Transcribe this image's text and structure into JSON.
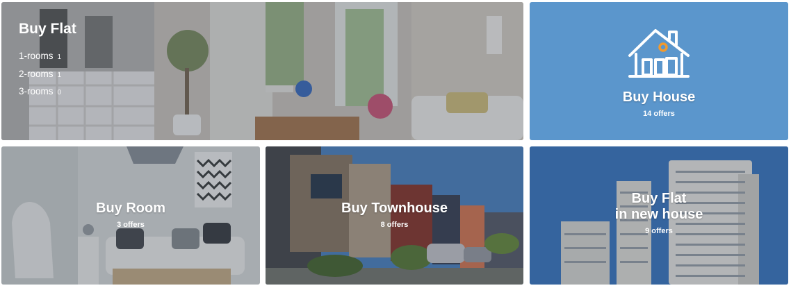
{
  "tiles": {
    "flat": {
      "title": "Buy Flat",
      "rooms": [
        {
          "label": "1-rooms",
          "count": "1"
        },
        {
          "label": "2-rooms",
          "count": "1"
        },
        {
          "label": "3-rooms",
          "count": "0"
        }
      ]
    },
    "house": {
      "title": "Buy House",
      "offers": "14 offers",
      "icon": "house-icon"
    },
    "room": {
      "title": "Buy Room",
      "offers": "3 offers"
    },
    "townhouse": {
      "title": "Buy Townhouse",
      "offers": "8 offers"
    },
    "new_flat": {
      "title_line1": "Buy Flat",
      "title_line2": "in new house",
      "offers": "9 offers"
    }
  },
  "colors": {
    "house_tile": "#5b96cc",
    "icon_accent": "#f29a2e"
  }
}
